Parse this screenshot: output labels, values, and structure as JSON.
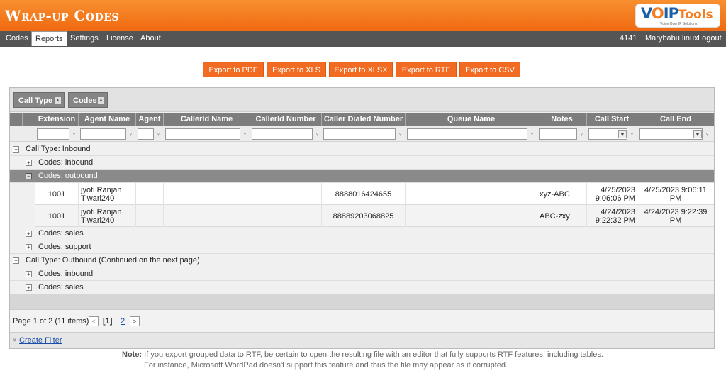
{
  "app": {
    "title": "Wrap-up Codes"
  },
  "logo": {
    "brand_v": "V",
    "brand_o": "O",
    "brand_ip": "IP",
    "brand_tools": "Tools",
    "tagline": "Voice Over IP Solutions"
  },
  "nav": {
    "items": [
      "Codes",
      "Reports",
      "Settings",
      "License",
      "About"
    ],
    "active": "Reports",
    "ext": "4141",
    "user": "Marybabu linux",
    "logout": "Logout"
  },
  "export_buttons": [
    "Export to PDF",
    "Export to XLS",
    "Export to XLSX",
    "Export to RTF",
    "Export to CSV"
  ],
  "group_panel": {
    "chips": [
      "Call Type",
      "Codes"
    ]
  },
  "columns": [
    "Extension",
    "Agent Name",
    "Agent",
    "CallerId Name",
    "CallerId Number",
    "Caller Dialed Number",
    "Queue Name",
    "Notes",
    "Call Start",
    "Call End"
  ],
  "groups": {
    "g1": "Call Type: Inbound",
    "g1a": "Codes: inbound",
    "g1b": "Codes: outbound",
    "g1c": "Codes: sales",
    "g1d": "Codes: support",
    "g2": "Call Type: Outbound (Continued on the next page)",
    "g2a": "Codes: inbound",
    "g2b": "Codes: sales"
  },
  "rows": [
    {
      "extension": "1001",
      "agent_name_1": "jyoti Ranjan",
      "agent_name_2": "Tiwari240",
      "agent": "",
      "callerid_name": "",
      "callerid_number": "",
      "dialed": "8888016424655",
      "queue": "",
      "notes": "xyz-ABC",
      "start_1": "4/25/2023",
      "start_2": "9:06:06 PM",
      "end_1": "4/25/2023 9:06:11",
      "end_2": "PM"
    },
    {
      "extension": "1001",
      "agent_name_1": "jyoti Ranjan",
      "agent_name_2": "Tiwari240",
      "agent": "",
      "callerid_name": "",
      "callerid_number": "",
      "dialed": "88889203068825",
      "queue": "",
      "notes": "ABC-zxy",
      "start_1": "4/24/2023",
      "start_2": "9:22:32 PM",
      "end_1": "4/24/2023 9:22:39",
      "end_2": "PM"
    }
  ],
  "pager": {
    "summary": "Page 1 of 2 (11 items)",
    "current": "[1]",
    "next_page": "2"
  },
  "footer": {
    "create_filter": "Create Filter"
  },
  "note": {
    "label": "Note:",
    "line1": "If you export grouped data to RTF, be certain to open the resulting file with an editor that fully supports RTF features, including tables.",
    "line2": "For instance, Microsoft WordPad doesn't support this feature and thus the file may appear as if corrupted."
  },
  "colors": {
    "header_orange": "#f47920",
    "nav_gray": "#555555",
    "button_orange": "#f26b22",
    "grid_header": "#7d7d7d",
    "link_blue": "#1a4fa8"
  }
}
